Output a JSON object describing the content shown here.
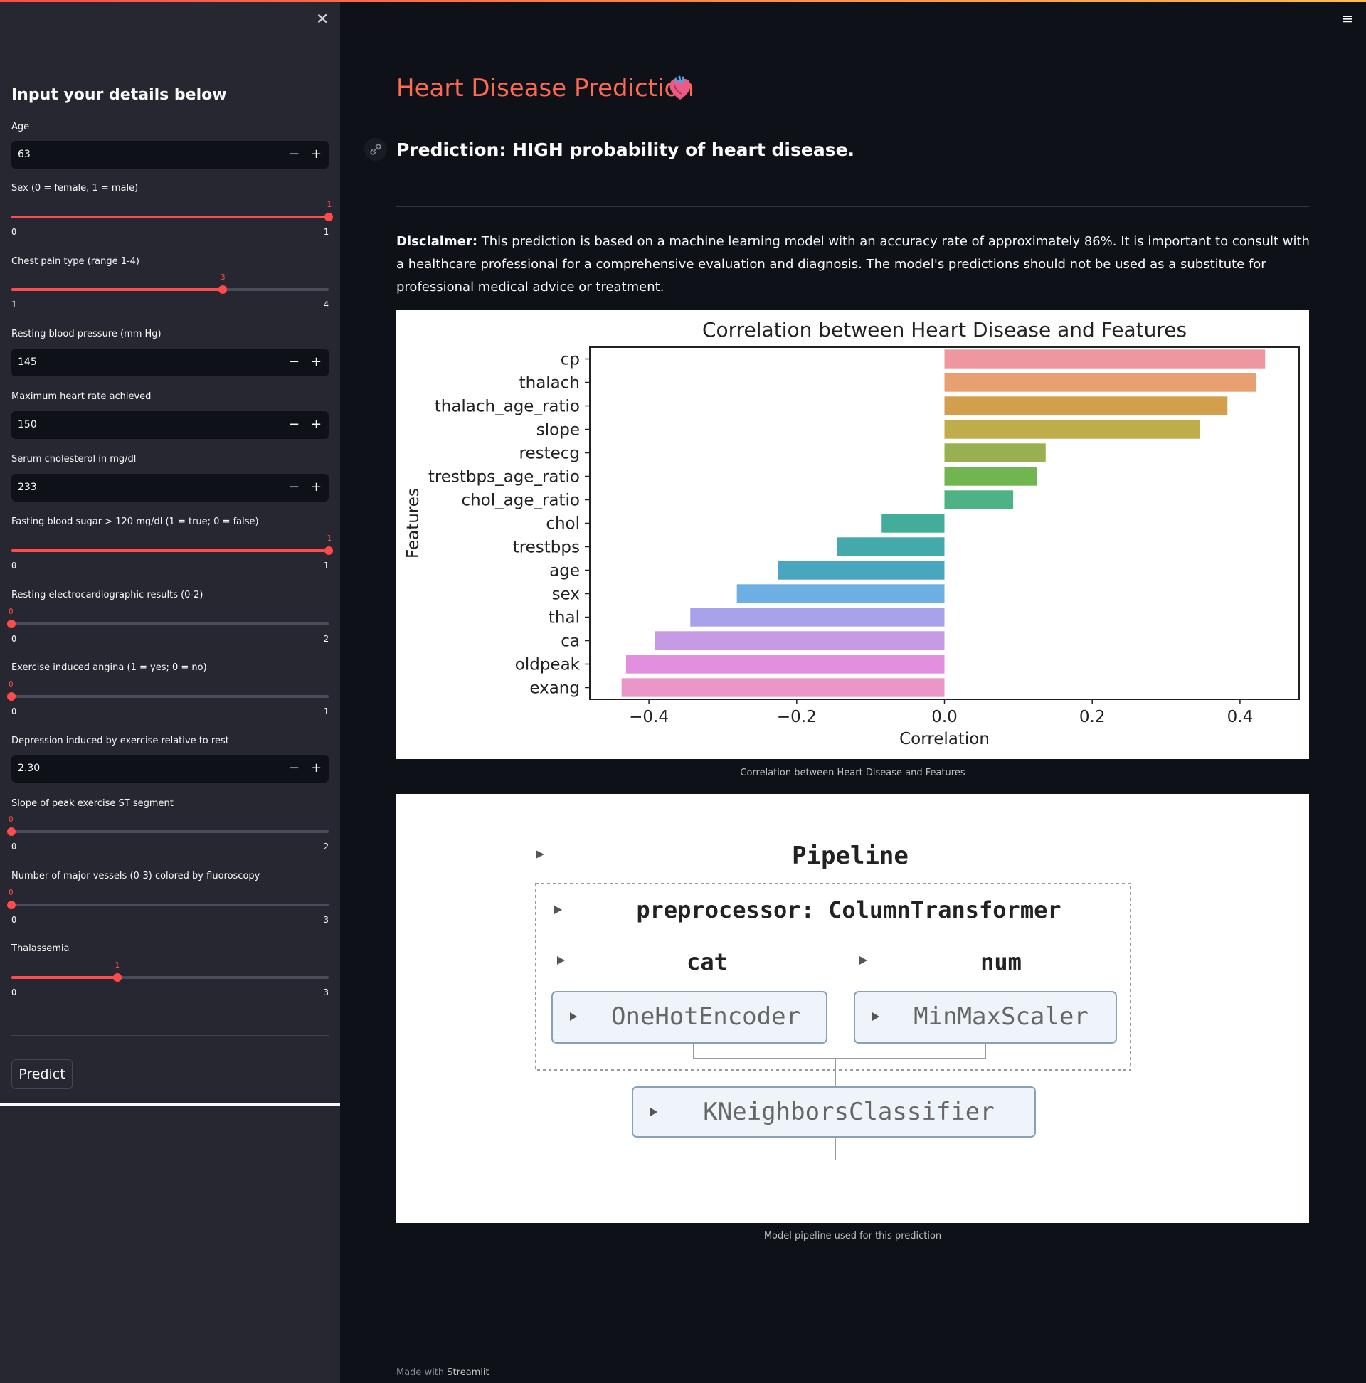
{
  "sidebar": {
    "title": "Input your details below",
    "fields": {
      "age": {
        "label": "Age",
        "value": "63"
      },
      "sex": {
        "label": "Sex (0 = female, 1 = male)",
        "value": 1,
        "min": 0,
        "max": 1
      },
      "cp": {
        "label": "Chest pain type (range 1-4)",
        "value": 3,
        "min": 1,
        "max": 4
      },
      "trestbps": {
        "label": "Resting blood pressure (mm Hg)",
        "value": "145"
      },
      "thalach": {
        "label": "Maximum heart rate achieved",
        "value": "150"
      },
      "chol": {
        "label": "Serum cholesterol in mg/dl",
        "value": "233"
      },
      "fbs": {
        "label": "Fasting blood sugar > 120 mg/dl (1 = true; 0 = false)",
        "value": 1,
        "min": 0,
        "max": 1
      },
      "restecg": {
        "label": "Resting electrocardiographic results (0-2)",
        "value": 0,
        "min": 0,
        "max": 2
      },
      "exang": {
        "label": "Exercise induced angina (1 = yes; 0 = no)",
        "value": 0,
        "min": 0,
        "max": 1
      },
      "oldpeak": {
        "label": "Depression induced by exercise relative to rest",
        "value": "2.30"
      },
      "slope": {
        "label": "Slope of peak exercise ST segment",
        "value": 0,
        "min": 0,
        "max": 2
      },
      "ca": {
        "label": "Number of major vessels (0-3) colored by fluoroscopy",
        "value": 0,
        "min": 0,
        "max": 3
      },
      "thal": {
        "label": "Thalassemia",
        "value": 1,
        "min": 0,
        "max": 3
      }
    },
    "stepper": {
      "minus": "−",
      "plus": "+"
    },
    "predict_label": "Predict",
    "close_glyph": "✕"
  },
  "menu_glyph": "≡",
  "main": {
    "title": "Heart Disease Prediction",
    "prediction": "Prediction: HIGH probability of heart disease.",
    "disclaimer_bold": "Disclaimer:",
    "disclaimer_text": " This prediction is based on a machine learning model with an accuracy rate of approximately 86%. It is important to consult with a healthcare professional for a comprehensive evaluation and diagnosis. The model's predictions should not be used as a substitute for professional medical advice or treatment.",
    "chart_caption": "Correlation between Heart Disease and Features",
    "pipeline_caption": "Model pipeline used for this prediction",
    "footer_prefix": "Made with ",
    "footer_brand": "Streamlit"
  },
  "pipeline": {
    "title": "Pipeline",
    "preprocessor": "preprocessor: ColumnTransformer",
    "branch_cat": "cat",
    "branch_num": "num",
    "cat_step": "OneHotEncoder",
    "num_step": "MinMaxScaler",
    "classifier": "KNeighborsClassifier"
  },
  "chart_data": {
    "type": "bar",
    "orientation": "horizontal",
    "title": "Correlation between Heart Disease and Features",
    "xlabel": "Correlation",
    "ylabel": "Features",
    "xlim": [
      -0.48,
      0.48
    ],
    "xticks": [
      -0.4,
      -0.2,
      0.0,
      0.2,
      0.4
    ],
    "xtick_labels": [
      "−0.4",
      "−0.2",
      "0.0",
      "0.2",
      "0.4"
    ],
    "categories": [
      "cp",
      "thalach",
      "thalach_age_ratio",
      "slope",
      "restecg",
      "trestbps_age_ratio",
      "chol_age_ratio",
      "chol",
      "trestbps",
      "age",
      "sex",
      "thal",
      "ca",
      "oldpeak",
      "exang"
    ],
    "values": [
      0.434,
      0.422,
      0.383,
      0.346,
      0.137,
      0.125,
      0.093,
      -0.085,
      -0.145,
      -0.225,
      -0.281,
      -0.344,
      -0.392,
      -0.431,
      -0.437
    ],
    "colors": [
      "#ee97a0",
      "#e9a071",
      "#d2a04c",
      "#bfac4a",
      "#99b050",
      "#70b550",
      "#4db384",
      "#43ad9c",
      "#44a9aa",
      "#48a6be",
      "#6daee3",
      "#a8a2ea",
      "#c79ae6",
      "#e38fe0",
      "#ea96c6"
    ],
    "grid": false
  }
}
